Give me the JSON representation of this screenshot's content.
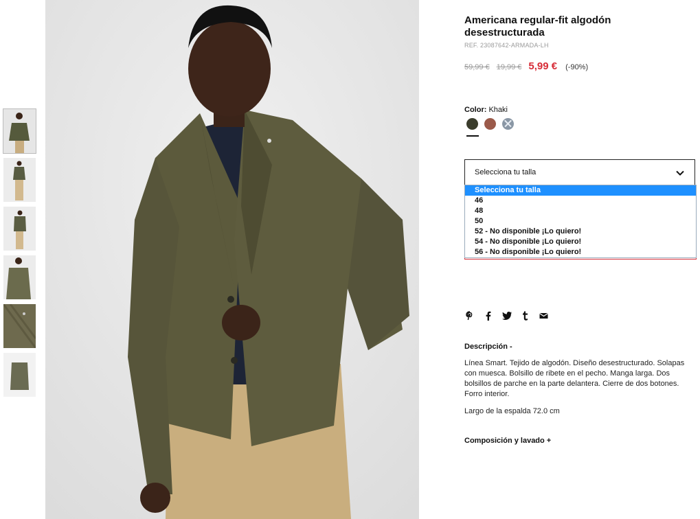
{
  "product": {
    "title": "Americana regular-fit algodón desestructurada",
    "ref": "REF. 23087642-ARMADA-LH",
    "price_old_1": "59,99 €",
    "price_old_2": "19,99 €",
    "price_now": "5,99 €",
    "discount": "(-90%)"
  },
  "color": {
    "label": "Color:",
    "selected": "Khaki",
    "swatches": [
      {
        "name": "khaki",
        "hex": "#3b3d2c",
        "available": true
      },
      {
        "name": "brown",
        "hex": "#9b5a4a",
        "available": true
      },
      {
        "name": "blue-grey",
        "hex": "#8a97a5",
        "available": false
      }
    ]
  },
  "size": {
    "placeholder": "Selecciona tu talla",
    "options": [
      "Selecciona tu talla",
      "46",
      "48",
      "50",
      "52 - No disponible ¡Lo quiero!",
      "54 - No disponible ¡Lo quiero!",
      "56 - No disponible ¡Lo quiero!"
    ]
  },
  "share": [
    "pinterest-icon",
    "facebook-icon",
    "twitter-icon",
    "tumblr-icon",
    "email-icon"
  ],
  "description": {
    "heading": "Descripción  -",
    "text": "Línea Smart. Tejido de algodón. Diseño desestructurado. Solapas con muesca. Bolsillo de ribete en el pecho. Manga larga. Dos bolsillos de parche en la parte delantera. Cierre de dos botones. Forro interior.",
    "length": "Largo de la espalda 72.0 cm"
  },
  "composition": {
    "heading": "Composición y lavado  +"
  },
  "colors": {
    "accent_red": "#d72c37",
    "select_blue": "#1e90ff"
  }
}
